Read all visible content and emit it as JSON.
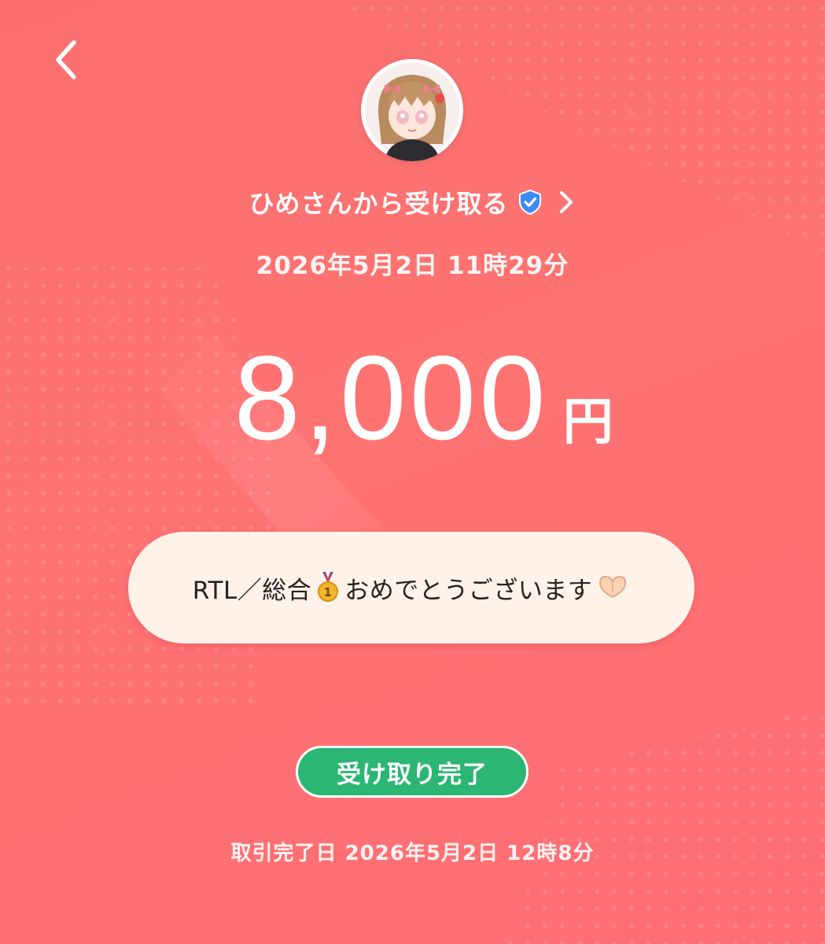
{
  "header": {
    "back_icon": "chevron-left-icon"
  },
  "sender": {
    "avatar_icon": "user-avatar",
    "label": "ひめさんから受け取る",
    "verified_icon": "verified-shield-icon",
    "chevron_icon": "chevron-right-icon"
  },
  "transfer": {
    "sent_date": "2026年5月2日 11時29分",
    "amount": "8,000",
    "unit": "円"
  },
  "message": {
    "text_part1": "RTL／総合",
    "medal_icon": "gold-medal-icon",
    "text_part2": "おめでとうございます",
    "heart_hands_icon": "heart-hands-icon"
  },
  "status": {
    "label": "受け取り完了",
    "color": "#2bb673"
  },
  "footer": {
    "completed_label": "取引完了日 2026年5月2日 12時8分"
  },
  "colors": {
    "background": "#ff7373",
    "bubble": "#fff2e9"
  }
}
